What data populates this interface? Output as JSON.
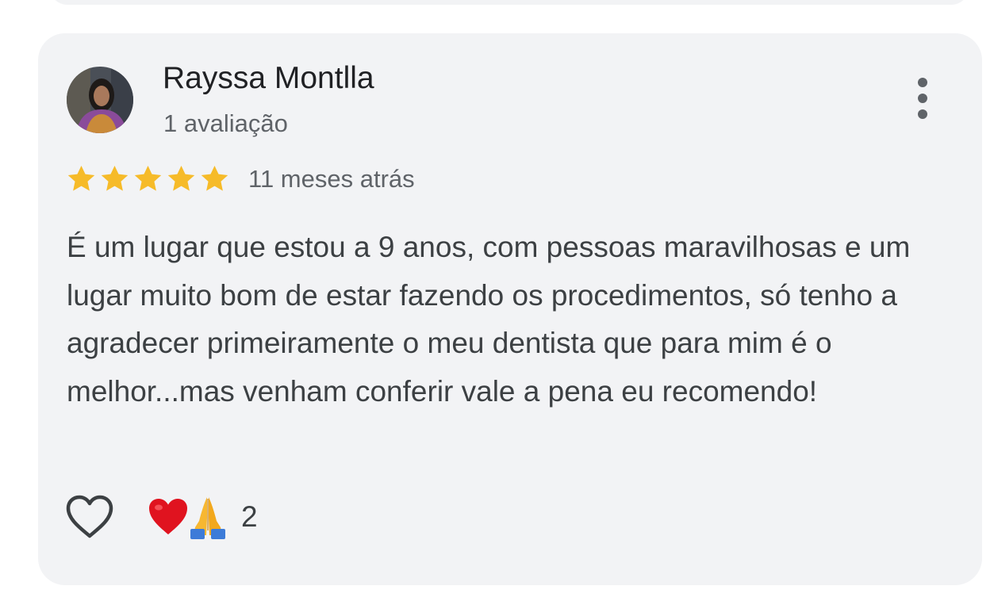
{
  "review": {
    "author_name": "Rayssa Montlla",
    "author_reviews": "1 avaliação",
    "rating": 5,
    "rating_max": 5,
    "time_ago": "11 meses atrás",
    "text": "É um lugar que estou a 9 anos, com pessoas maravilhosas e um lugar muito bom de estar fazendo os procedimentos, só tenho a agradecer primeiramente o meu dentista que para mim é o melhor...mas venham conferir vale a pena eu recomendo!",
    "reactions": [
      "heart",
      "folded-hands"
    ],
    "reaction_count": "2"
  },
  "icons": {
    "more": "more-vert-icon",
    "like": "heart-outline-icon",
    "star": "star-icon"
  },
  "colors": {
    "card_background": "#f2f3f5",
    "star": "#f6bb29",
    "primary_text": "#202124",
    "secondary_text": "#5f6368",
    "body_text": "#3c4043"
  }
}
